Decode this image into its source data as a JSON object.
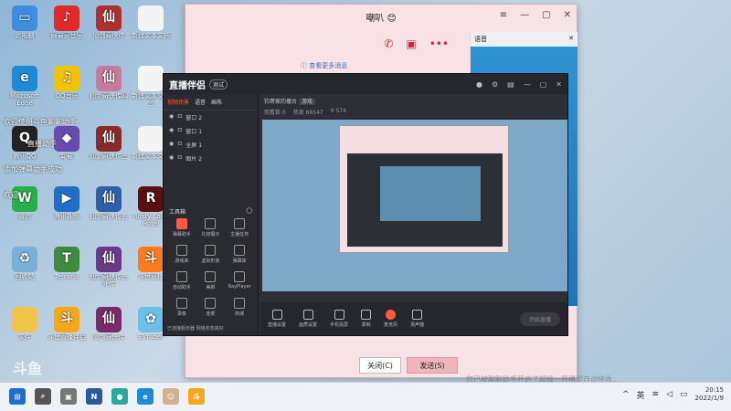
{
  "desktop_icons": [
    {
      "label": "此电脑",
      "icon": "computer-icon",
      "color": "#3d8ee0",
      "glyph": "▭"
    },
    {
      "label": "网易云音乐",
      "icon": "netease-music-icon",
      "color": "#e02a2a",
      "glyph": "♪"
    },
    {
      "label": "仙剑奇侠传",
      "icon": "game-icon",
      "color": "#b03030",
      "glyph": "仙"
    },
    {
      "label": "新建文本文档",
      "icon": "document-icon",
      "color": "#f4f4f4",
      "glyph": ""
    },
    {
      "label": "Microsoft Edge",
      "icon": "edge-icon",
      "color": "#1e8ad6",
      "glyph": "e"
    },
    {
      "label": "QQ音乐",
      "icon": "qq-music-icon",
      "color": "#f2c400",
      "glyph": "♫"
    },
    {
      "label": "仙剑奇侠传四",
      "icon": "game-icon",
      "color": "#c77a9a",
      "glyph": "仙"
    },
    {
      "label": "新建文本文档三",
      "icon": "document-icon",
      "color": "#f4f4f4",
      "glyph": ""
    },
    {
      "label": "腾讯QQ",
      "icon": "qq-icon",
      "color": "#222",
      "glyph": "Q"
    },
    {
      "label": "卸载",
      "icon": "uninstall-icon",
      "color": "#6a4ab0",
      "glyph": "◆"
    },
    {
      "label": "仙剑奇侠传三",
      "icon": "game-icon",
      "color": "#8a2a2a",
      "glyph": "仙"
    },
    {
      "label": "新建文本文档",
      "icon": "document-icon",
      "color": "#f4f4f4",
      "glyph": ""
    },
    {
      "label": "微信",
      "icon": "wechat-icon",
      "color": "#2aae4a",
      "glyph": "W"
    },
    {
      "label": "腾讯视频",
      "icon": "video-icon",
      "color": "#1f6fc9",
      "glyph": "▶"
    },
    {
      "label": "仙剑奇侠传五",
      "icon": "game-icon",
      "color": "#2f5fa8",
      "glyph": "仙"
    },
    {
      "label": "Rusty Lake Hotel",
      "icon": "game-icon",
      "color": "#5a1010",
      "glyph": "R"
    },
    {
      "label": "回收站",
      "icon": "recycle-bin-icon",
      "color": "#7ab0d8",
      "glyph": "♻"
    },
    {
      "label": "Terraria",
      "icon": "terraria-icon",
      "color": "#3f8a3f",
      "glyph": "T"
    },
    {
      "label": "仙剑奇侠传三外传",
      "icon": "game-icon",
      "color": "#6a3a8a",
      "glyph": "仙"
    },
    {
      "label": "斗鱼直播",
      "icon": "douyu-icon",
      "color": "#ff7a1a",
      "glyph": "斗"
    },
    {
      "label": "文件",
      "icon": "folder-icon",
      "color": "#f2c44a",
      "glyph": ""
    },
    {
      "label": "斗鱼直播伴侣",
      "icon": "douyu-icon",
      "color": "#f6a81a",
      "glyph": "斗"
    },
    {
      "label": "仙剑奇侠传",
      "icon": "game-icon",
      "color": "#7a2a6a",
      "glyph": "仙"
    },
    {
      "label": "EVtuber",
      "icon": "evtuber-icon",
      "color": "#6ac0e8",
      "glyph": "✿"
    }
  ],
  "toasts": [
    "欢迎使用斗鱼聊聊助手",
    "直播助手",
    "添加弹幕助手成功",
    "欢迎"
  ],
  "chat": {
    "title": "嘲叭 😊",
    "more_messages": "查看更多消息",
    "voice_panel_title": "语音",
    "close_label": "关闭(C)",
    "send_label": "发送(S)"
  },
  "broadcast": {
    "app_name": "直播伴侣",
    "badge": "测试",
    "tabs": [
      "视频场景",
      "语音",
      "画布"
    ],
    "scenes": [
      "窗口 2",
      "窗口 1",
      "全屏 1",
      "图片 2"
    ],
    "room_title": "钧哥家的播台",
    "room_tag": "游戏",
    "room_stats": [
      "观看数 0",
      "热度 66547",
      "¥ 574"
    ],
    "tools_title": "工具箱",
    "tools": [
      "弹幕助手",
      "礼物展示",
      "主播任务",
      "游戏库",
      "虚拟形象",
      "弹幕库",
      "自动助手",
      "美颜",
      "RayPlayer",
      "录像",
      "连麦",
      "商城"
    ],
    "status": "已连接服务器 网络状态良好",
    "bottom_tools": [
      "直播设置",
      "画质设置",
      "手机投屏",
      "录制",
      "麦克风",
      "扬声器"
    ],
    "start_label": "开始直播"
  },
  "watermark": "斗鱼",
  "ticker": "您已被聊聊助手开启了超级一开播即自动接收...",
  "taskbar": {
    "apps": [
      {
        "icon": "start-icon",
        "color": "#1f6fc9",
        "glyph": "⊞"
      },
      {
        "icon": "search-icon",
        "color": "#555",
        "glyph": "⌕"
      },
      {
        "icon": "task-view-icon",
        "color": "#777",
        "glyph": "▣"
      },
      {
        "icon": "netease-icon",
        "color": "#2a5a9a",
        "glyph": "N"
      },
      {
        "icon": "app-icon",
        "color": "#2aa89a",
        "glyph": "●"
      },
      {
        "icon": "edge-icon",
        "color": "#1e8ad6",
        "glyph": "e"
      },
      {
        "icon": "avatar-app-icon",
        "color": "#d4b090",
        "glyph": "☺"
      },
      {
        "icon": "douyu-icon",
        "color": "#f6a81a",
        "glyph": "斗"
      }
    ],
    "lang": "英",
    "time": "20:15",
    "date": "2022/1/9"
  }
}
